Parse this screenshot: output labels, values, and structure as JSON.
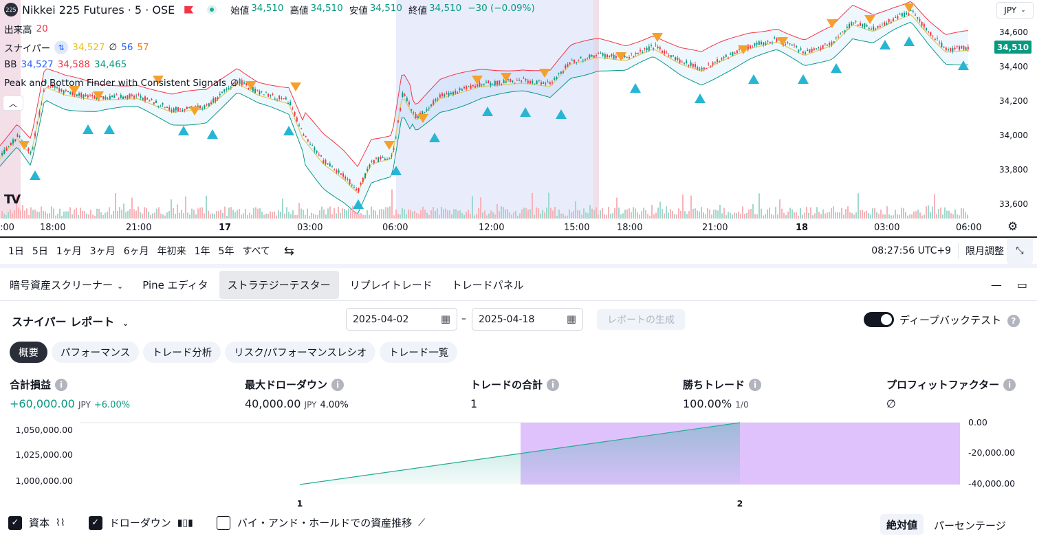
{
  "symbol": {
    "badge": "225",
    "title": "Nikkei 225 Futures · 5 · OSE",
    "ohlc": [
      {
        "label": "始値",
        "value": "34,510"
      },
      {
        "label": "高値",
        "value": "34,510"
      },
      {
        "label": "安値",
        "value": "34,510"
      },
      {
        "label": "終値",
        "value": "34,510"
      }
    ],
    "change": "−30 (−0.09%)",
    "currency": "JPY",
    "last_price": "34,510"
  },
  "indicators": {
    "volume": {
      "label": "出来高",
      "value": "20"
    },
    "sniper": {
      "label": "スナイパー",
      "v1": "34,527",
      "v2": "56",
      "v3": "57",
      "null_sym": "∅"
    },
    "bb": {
      "label": "BB",
      "basis": "34,527",
      "upper": "34,588",
      "lower": "34,465"
    },
    "peak": {
      "label": "Peak and Bottom Finder with Consistent Signals",
      "null_sym": "∅"
    }
  },
  "price_axis": [
    "34,600",
    "34,400",
    "34,200",
    "34,000",
    "33,800",
    "33,600"
  ],
  "time_axis": [
    {
      "label": ":00",
      "bold": false
    },
    {
      "label": "18:00",
      "bold": false
    },
    {
      "label": "21:00",
      "bold": false
    },
    {
      "label": "17",
      "bold": true
    },
    {
      "label": "03:00",
      "bold": false
    },
    {
      "label": "06:00",
      "bold": false
    },
    {
      "label": "12:00",
      "bold": false
    },
    {
      "label": "15:00",
      "bold": false
    },
    {
      "label": "18:00",
      "bold": false
    },
    {
      "label": "21:00",
      "bold": false
    },
    {
      "label": "18",
      "bold": true
    },
    {
      "label": "03:00",
      "bold": false
    },
    {
      "label": "06:00",
      "bold": false
    }
  ],
  "timeframes": [
    "1日",
    "5日",
    "1ヶ月",
    "3ヶ月",
    "6ヶ月",
    "年初来",
    "1年",
    "5年",
    "すべて"
  ],
  "clock": "08:27:56 UTC+9",
  "contract_adjust": "限月調整",
  "panel_tabs": [
    {
      "label": "暗号資産スクリーナー",
      "chevron": "⌄"
    },
    {
      "label": "Pine エディタ"
    },
    {
      "label": "ストラテジーテスター",
      "active": true
    },
    {
      "label": "リプレイトレード"
    },
    {
      "label": "トレードパネル"
    }
  ],
  "report": {
    "title": "スナイパー レポート",
    "date_from": "2025-04-02",
    "date_to": "2025-04-18",
    "dash": "–",
    "generate": "レポートの生成",
    "deep_backtest": "ディープバックテスト",
    "deep_backtest_on": true
  },
  "sub_tabs": [
    {
      "label": "概要",
      "active": true
    },
    {
      "label": "パフォーマンス"
    },
    {
      "label": "トレード分析"
    },
    {
      "label": "リスク/パフォーマンスレシオ"
    },
    {
      "label": "トレード一覧"
    }
  ],
  "metrics": {
    "net_profit": {
      "label": "合計損益",
      "value": "+60,000.00",
      "unit": "JPY",
      "pct": "+6.00%"
    },
    "max_drawdown": {
      "label": "最大ドローダウン",
      "value": "40,000.00",
      "unit": "JPY",
      "pct": "4.00%"
    },
    "total_trades": {
      "label": "トレードの合計",
      "value": "1"
    },
    "win_trades": {
      "label": "勝ちトレード",
      "value": "100.00%",
      "ratio": "1/0"
    },
    "profit_factor": {
      "label": "プロフィットファクター",
      "value": "∅"
    }
  },
  "chart_data": {
    "type": "line",
    "x": [
      1,
      2
    ],
    "series": [
      {
        "name": "資本",
        "values": [
          1000000,
          1060000
        ],
        "color": "#22ab94"
      },
      {
        "name": "ドローダウン",
        "values": [
          -40000,
          -40000
        ],
        "color": "#ce93d8"
      }
    ],
    "ylim_left": [
      990000,
      1060000
    ],
    "ylim_right": [
      -40000,
      0
    ],
    "left_ticks": [
      "1,050,000.00",
      "1,025,000.00",
      "1,000,000.00"
    ],
    "right_ticks": [
      "0.00",
      "-20,000.00",
      "-40,000.00"
    ],
    "x_ticks": [
      "1",
      "2"
    ]
  },
  "checkboxes": [
    {
      "label": "資本",
      "checked": true,
      "icon": "equity-icon"
    },
    {
      "label": "ドローダウン",
      "checked": true,
      "icon": "drawdown-icon"
    },
    {
      "label": "バイ・アンド・ホールドでの資産推移",
      "checked": false,
      "icon": "buyhold-icon"
    }
  ],
  "view_modes": {
    "absolute": "絶対値",
    "percent": "パーセンテージ"
  }
}
